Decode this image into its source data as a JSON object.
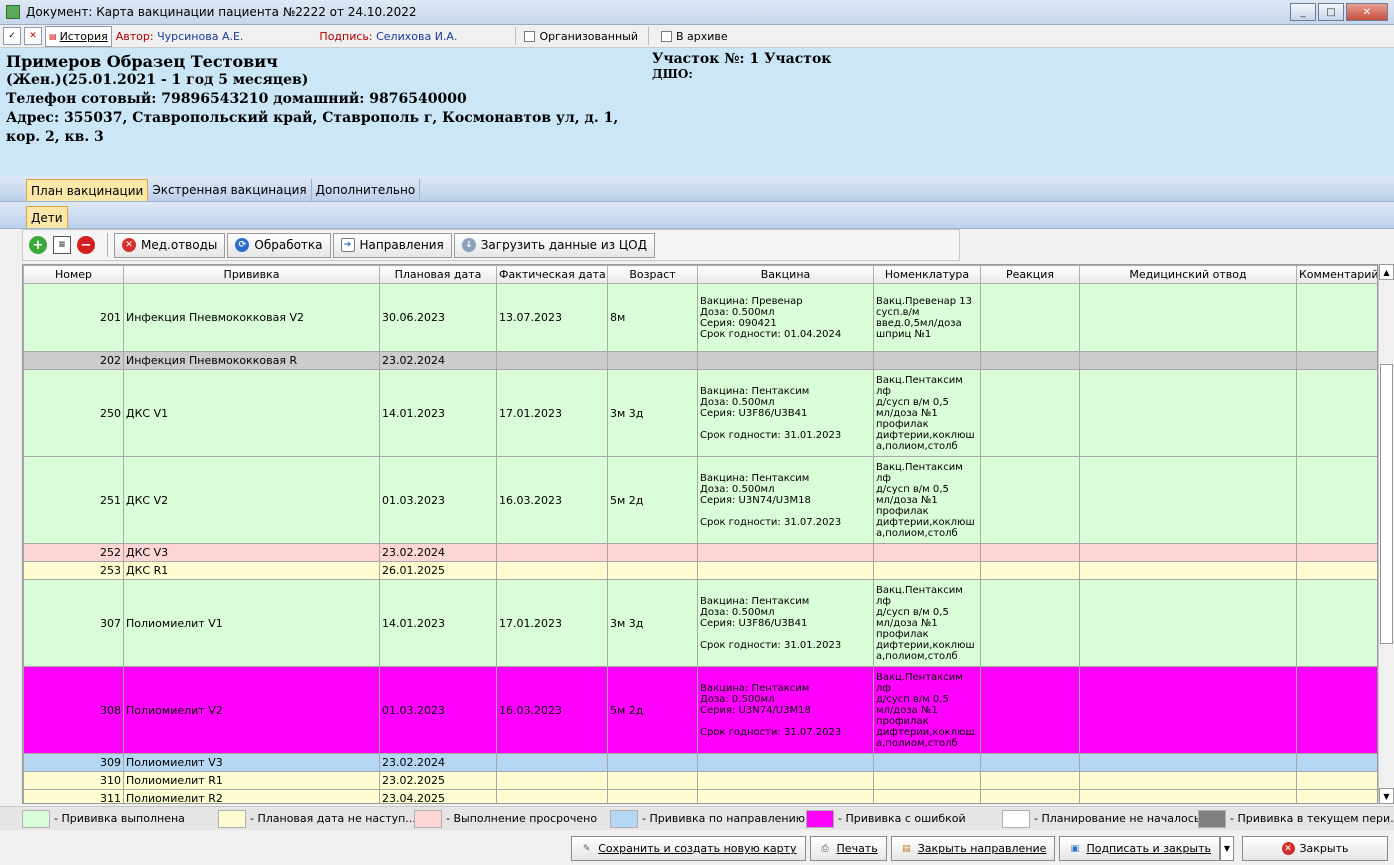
{
  "window": {
    "title": "Документ: Карта вакцинации пациента №2222 от 24.10.2022"
  },
  "toolbar": {
    "history_label": "История",
    "author_key": "Автор:",
    "author": "Чурсинова А.Е.",
    "sign_key": "Подпись:",
    "signer": "Селихова И.А.",
    "organized_label": "Организованный",
    "archive_label": "В архиве"
  },
  "patient": {
    "name": "Примеров Образец Тестович",
    "info": "(Жен.)(25.01.2021 - 1 год 5 месяцев)",
    "phones": "Телефон сотовый: 79896543210 домашний: 9876540000",
    "address": "Адрес: 355037, Ставропольский край, Ставрополь г, Космонавтов ул, д. 1, кор. 2, кв. 3",
    "district": "Участок №: 1 Участок",
    "dshu": "ДШО:"
  },
  "tabs": [
    "План вакцинации",
    "Экстренная вакцинация",
    "Дополнительно"
  ],
  "subtabs": [
    "Дети"
  ],
  "actions": {
    "med_label": "Мед.отводы",
    "proc_label": "Обработка",
    "dir_label": "Направления",
    "load_label": "Загрузить данные из ЦОД"
  },
  "columns": [
    "Номер",
    "Прививка",
    "Плановая дата",
    "Фактическая дата",
    "Возраст",
    "Вакцина",
    "Номенклатура",
    "Реакция",
    "Медицинский отвод",
    "Комментарий"
  ],
  "rows": [
    {
      "num": "201",
      "name": "Инфекция Пневмококковая V2",
      "plan": "30.06.2023",
      "fact": "13.07.2023",
      "age": "8м",
      "vaccine": "Вакцина: Превенар\nДоза: 0.500мл\nСерия: 090421\nСрок годности: 01.04.2024",
      "nom": "Вакц.Превенар 13\nсусп.в/м\nввед.0,5мл/доза\nшприц №1",
      "status": "done"
    },
    {
      "num": "202",
      "name": "Инфекция Пневмококковая R",
      "plan": "23.02.2024",
      "fact": "",
      "age": "",
      "vaccine": "",
      "nom": "",
      "status": "cur"
    },
    {
      "num": "250",
      "name": "ДКС V1",
      "plan": "14.01.2023",
      "fact": "17.01.2023",
      "age": "3м 3д",
      "vaccine": "Вакцина: Пентаксим\nДоза: 0.500мл\nСерия: U3F86/U3B41\n\nСрок годности: 31.01.2023",
      "nom": "Вакц.Пентаксим лф\nд/сусп в/м 0,5\nмл/доза №1\nпрофилак\nдифтерии,коклюш\nа,полиом,столб",
      "status": "done"
    },
    {
      "num": "251",
      "name": "ДКС V2",
      "plan": "01.03.2023",
      "fact": "16.03.2023",
      "age": "5м 2д",
      "vaccine": "Вакцина: Пентаксим\nДоза: 0.500мл\nСерия: U3N74/U3M18\n\nСрок годности: 31.07.2023",
      "nom": "Вакц.Пентаксим лф\nд/сусп в/м 0,5\nмл/доза №1\nпрофилак\nдифтерии,коклюш\nа,полиом,столб",
      "status": "done"
    },
    {
      "num": "252",
      "name": "ДКС V3",
      "plan": "23.02.2024",
      "fact": "",
      "age": "",
      "vaccine": "",
      "nom": "",
      "status": "over"
    },
    {
      "num": "253",
      "name": "ДКС R1",
      "plan": "26.01.2025",
      "fact": "",
      "age": "",
      "vaccine": "",
      "nom": "",
      "status": "future"
    },
    {
      "num": "307",
      "name": "Полиомиелит V1",
      "plan": "14.01.2023",
      "fact": "17.01.2023",
      "age": "3м 3д",
      "vaccine": "Вакцина: Пентаксим\nДоза: 0.500мл\nСерия: U3F86/U3B41\n\nСрок годности: 31.01.2023",
      "nom": "Вакц.Пентаксим лф\nд/сусп в/м 0,5\nмл/доза №1\nпрофилак\nдифтерии,коклюш\nа,полиом,столб",
      "status": "done"
    },
    {
      "num": "308",
      "name": "Полиомиелит V2",
      "plan": "01.03.2023",
      "fact": "16.03.2023",
      "age": "5м 2д",
      "vaccine": "Вакцина: Пентаксим\nДоза: 0.500мл\nСерия: U3N74/U3M18\n\nСрок годности: 31.07.2023",
      "nom": "Вакц.Пентаксим лф\nд/сусп в/м 0,5\nмл/доза №1\nпрофилак\nдифтерии,коклюш\nа,полиом,столб",
      "status": "err"
    },
    {
      "num": "309",
      "name": "Полиомиелит V3",
      "plan": "23.02.2024",
      "fact": "",
      "age": "",
      "vaccine": "",
      "nom": "",
      "status": "dir"
    },
    {
      "num": "310",
      "name": "Полиомиелит R1",
      "plan": "23.02.2025",
      "fact": "",
      "age": "",
      "vaccine": "",
      "nom": "",
      "status": "future"
    },
    {
      "num": "311",
      "name": "Полиомиелит R2",
      "plan": "23.04.2025",
      "fact": "",
      "age": "",
      "vaccine": "",
      "nom": "",
      "status": "future"
    }
  ],
  "legend": [
    {
      "color": "#d9fdd6",
      "label": "- Прививка выполнена"
    },
    {
      "color": "#fdfdd1",
      "label": "- Плановая дата не наступ..."
    },
    {
      "color": "#fdd5d5",
      "label": "- Выполнение просрочено"
    },
    {
      "color": "#b6d7f3",
      "label": "- Прививка по направлению"
    },
    {
      "color": "#ff00ff",
      "label": "- Прививка с ошибкой"
    },
    {
      "color": "#ffffff",
      "label": "- Планирование не началось"
    },
    {
      "color": "#808080",
      "label": "- Прививка в текущем пери..."
    }
  ],
  "bottom": {
    "save_new": "Сохранить и создать новую карту",
    "print": "Печать",
    "close_dir": "Закрыть направление",
    "sign_close": "Подписать и закрыть",
    "close": "Закрыть"
  }
}
